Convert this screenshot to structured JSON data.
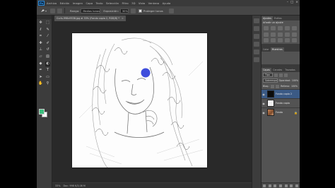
{
  "menubar": {
    "logo": "Ps",
    "items": [
      "Archivo",
      "Edición",
      "Imagen",
      "Capa",
      "Texto",
      "Selección",
      "Filtro",
      "3D",
      "Vista",
      "Ventana",
      "Ayuda"
    ]
  },
  "options": {
    "mode_label": "Modo:",
    "mode_value": "Normal",
    "rango_label": "Rango:",
    "rango_value": "Medios tonos",
    "exposure_label": "Exposición:",
    "exposure_value": "30%",
    "protect_label": "Proteger tonos",
    "protect_checked": true
  },
  "document": {
    "tab_title": "Curls-998x9538.jpg al 33% (Fondo copia 2, RGB/8) *",
    "tab_close": "×"
  },
  "status": {
    "zoom": "33%",
    "doc": "Doc: 998 K/3,08 M"
  },
  "adjustments": {
    "tabs": [
      "Ajustes",
      "Estilos"
    ],
    "title": "Añadir un ajuste"
  },
  "panel_tabs_mid": [
    "Color",
    "Muestras"
  ],
  "layers": {
    "tabs": [
      "Capas",
      "Canales",
      "Trazados"
    ],
    "kind_label": "Tipo",
    "blend_mode": "Sobreexponer color",
    "opacity_label": "Opacidad:",
    "opacity_value": "100%",
    "lock_label": "Bloq.:",
    "fill_label": "Relleno:",
    "fill_value": "100%",
    "items": [
      {
        "name": "Fondo copia 2",
        "selected": true,
        "thumb": "dark"
      },
      {
        "name": "Fondo copia",
        "selected": false,
        "thumb": "sketch"
      },
      {
        "name": "Fondo",
        "selected": false,
        "thumb": "photo",
        "locked": true
      }
    ]
  },
  "colors": {
    "foreground": "#3bbf7d",
    "background": "#ffffff",
    "brush_dot": "#2a3bd8",
    "selected_layer": "#3b5a85"
  }
}
